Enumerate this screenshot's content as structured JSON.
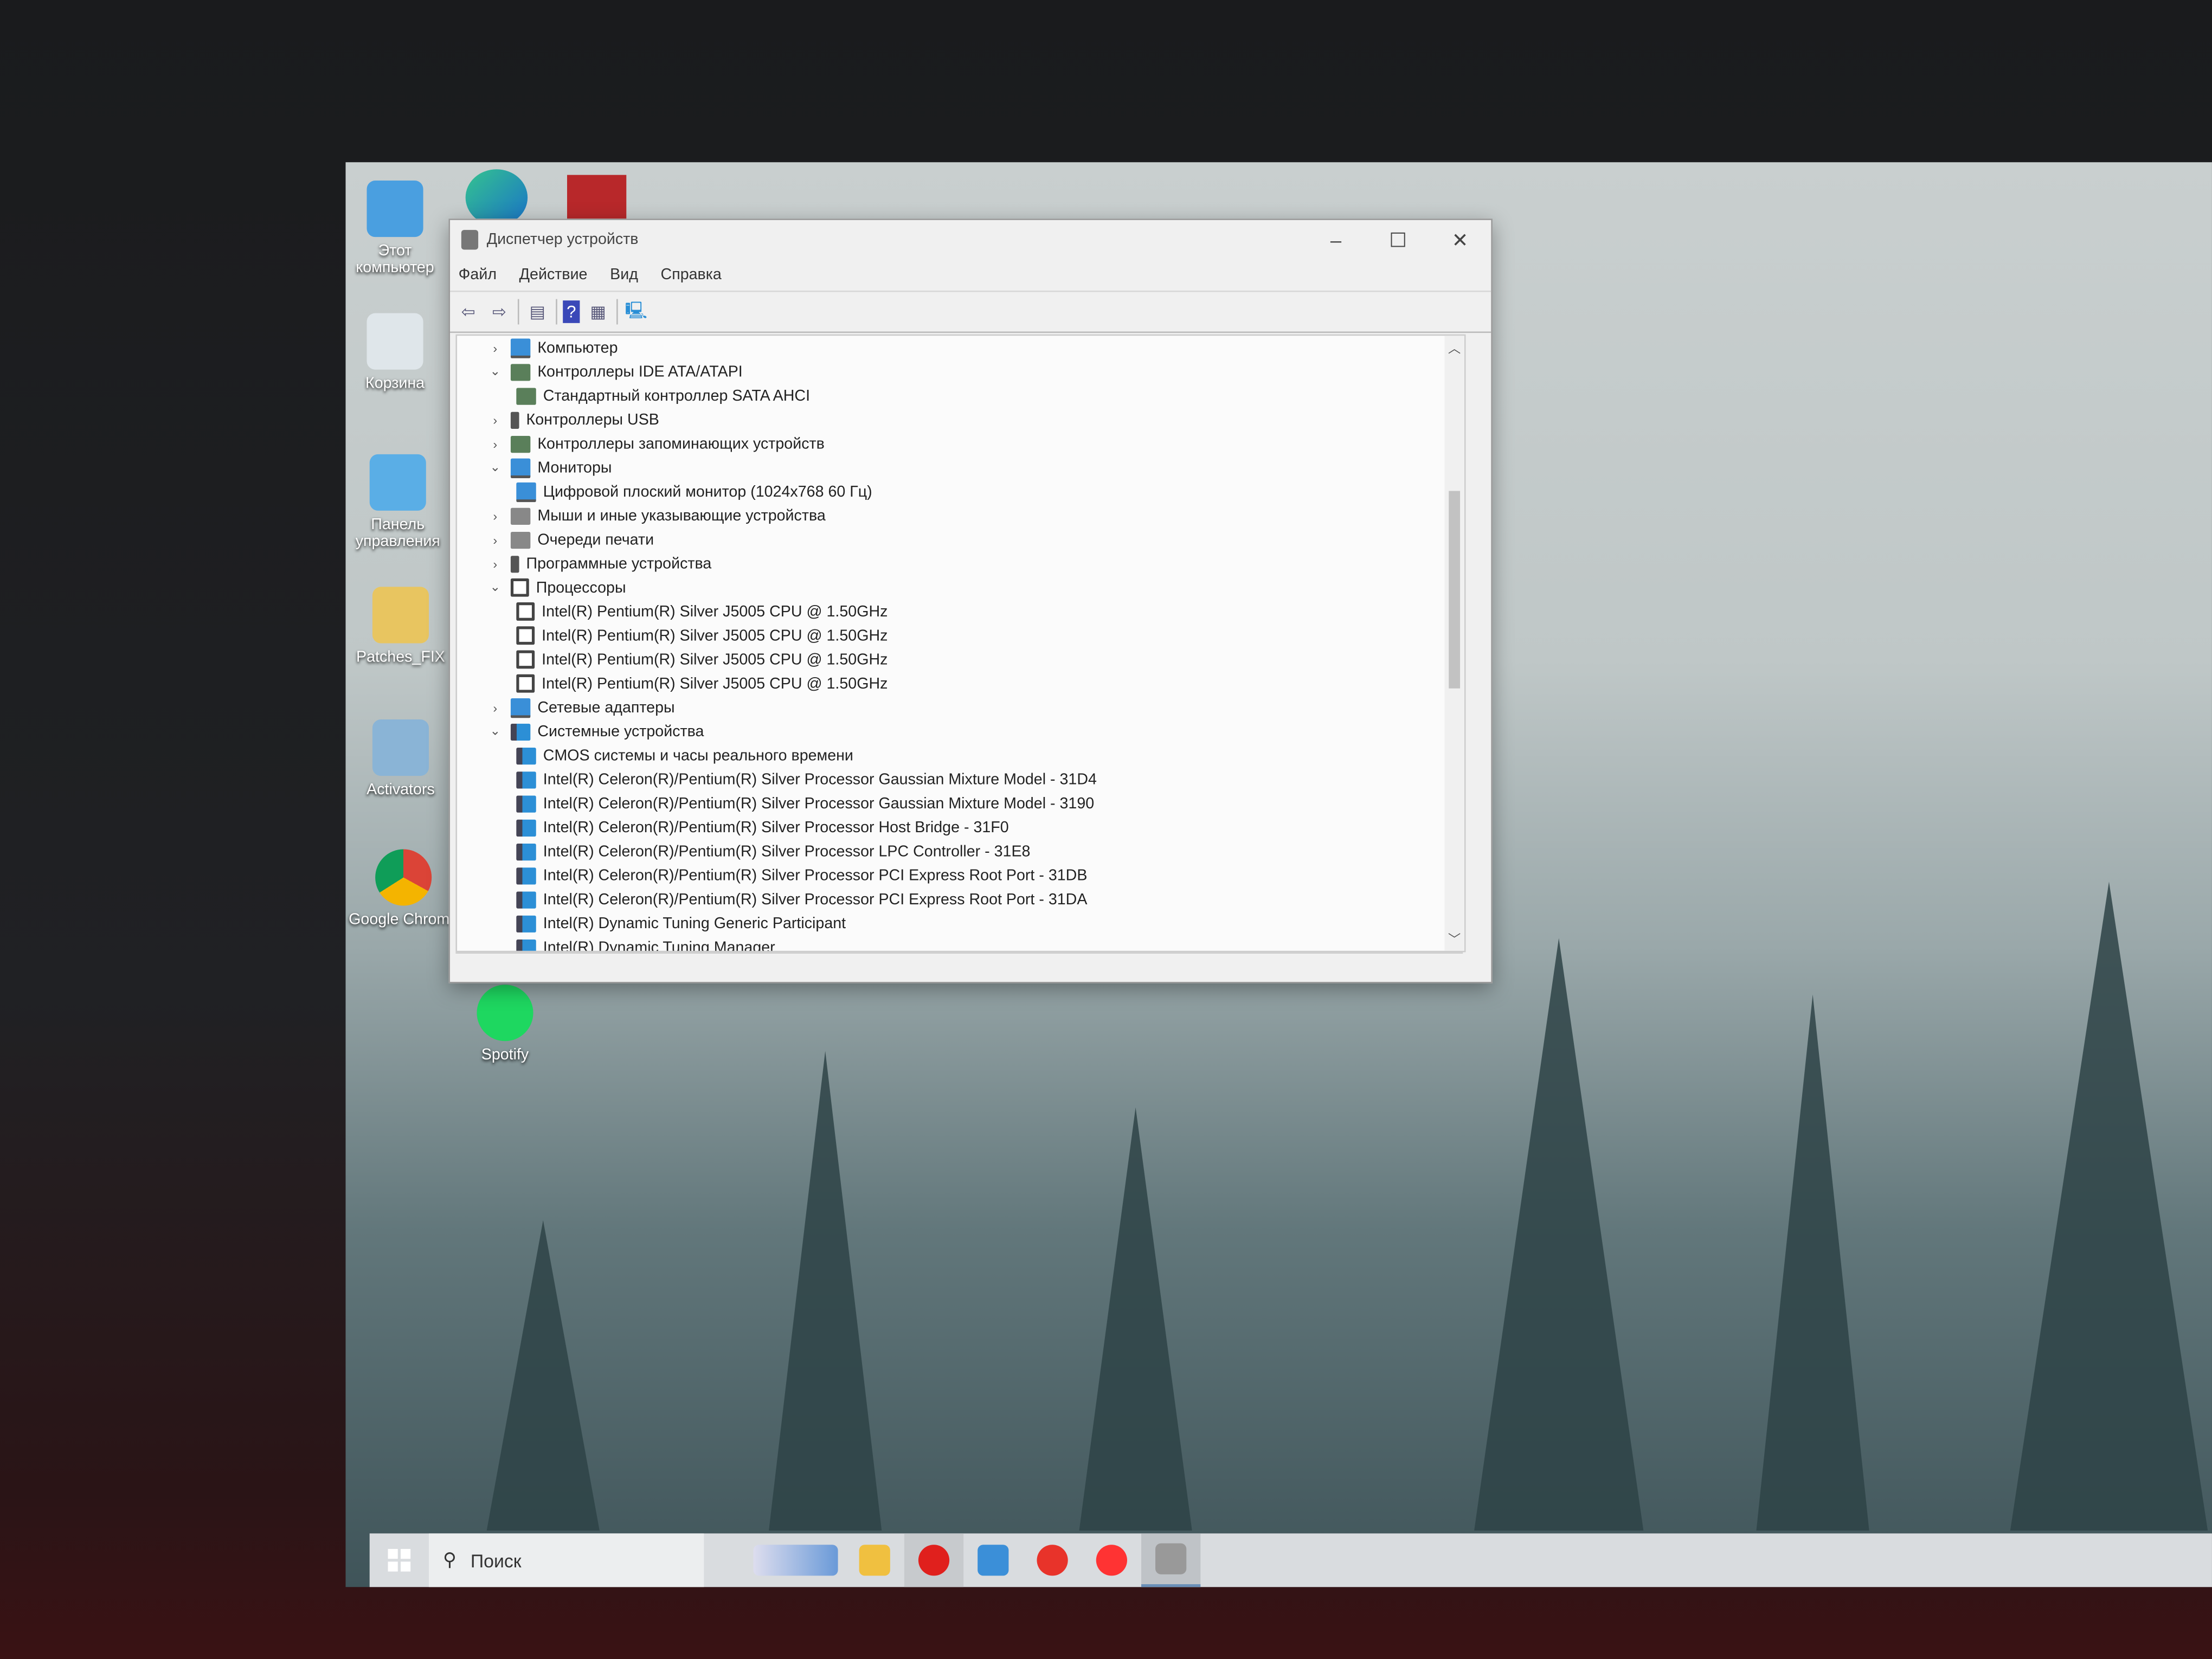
{
  "window": {
    "title": "Диспетчер устройств",
    "menu": [
      "Файл",
      "Действие",
      "Вид",
      "Справка"
    ],
    "controls": {
      "minimize": "–",
      "maximize": "☐",
      "close": "✕"
    }
  },
  "tree": [
    {
      "label": "Компьютер",
      "level": 0,
      "state": "collapsed",
      "icon": "computer-icon"
    },
    {
      "label": "Контроллеры IDE ATA/ATAPI",
      "level": 0,
      "state": "expanded",
      "icon": "controller-icon"
    },
    {
      "label": "Стандартный контроллер SATA AHCI",
      "level": 1,
      "icon": "controller-icon"
    },
    {
      "label": "Контроллеры USB",
      "level": 0,
      "state": "collapsed",
      "icon": "usb-icon"
    },
    {
      "label": "Контроллеры запоминающих устройств",
      "level": 0,
      "state": "collapsed",
      "icon": "storage-icon"
    },
    {
      "label": "Мониторы",
      "level": 0,
      "state": "expanded",
      "icon": "monitor-icon"
    },
    {
      "label": "Цифровой плоский монитор (1024x768 60 Гц)",
      "level": 1,
      "icon": "monitor-icon"
    },
    {
      "label": "Мыши и иные указывающие устройства",
      "level": 0,
      "state": "collapsed",
      "icon": "mouse-icon"
    },
    {
      "label": "Очереди печати",
      "level": 0,
      "state": "collapsed",
      "icon": "printer-icon"
    },
    {
      "label": "Программные устройства",
      "level": 0,
      "state": "collapsed",
      "icon": "software-device-icon"
    },
    {
      "label": "Процессоры",
      "level": 0,
      "state": "expanded",
      "icon": "cpu-icon"
    },
    {
      "label": "Intel(R) Pentium(R) Silver J5005 CPU @ 1.50GHz",
      "level": 1,
      "icon": "cpu-icon"
    },
    {
      "label": "Intel(R) Pentium(R) Silver J5005 CPU @ 1.50GHz",
      "level": 1,
      "icon": "cpu-icon"
    },
    {
      "label": "Intel(R) Pentium(R) Silver J5005 CPU @ 1.50GHz",
      "level": 1,
      "icon": "cpu-icon"
    },
    {
      "label": "Intel(R) Pentium(R) Silver J5005 CPU @ 1.50GHz",
      "level": 1,
      "icon": "cpu-icon"
    },
    {
      "label": "Сетевые адаптеры",
      "level": 0,
      "state": "collapsed",
      "icon": "network-icon"
    },
    {
      "label": "Системные устройства",
      "level": 0,
      "state": "expanded",
      "icon": "system-icon"
    },
    {
      "label": "CMOS системы и часы реального времени",
      "level": 1,
      "icon": "system-icon"
    },
    {
      "label": "Intel(R) Celeron(R)/Pentium(R) Silver Processor Gaussian Mixture Model - 31D4",
      "level": 1,
      "icon": "system-icon"
    },
    {
      "label": "Intel(R) Celeron(R)/Pentium(R) Silver Processor Gaussian Mixture Model - 3190",
      "level": 1,
      "icon": "system-icon"
    },
    {
      "label": "Intel(R) Celeron(R)/Pentium(R) Silver Processor Host Bridge - 31F0",
      "level": 1,
      "icon": "system-icon"
    },
    {
      "label": "Intel(R) Celeron(R)/Pentium(R) Silver Processor LPC Controller - 31E8",
      "level": 1,
      "icon": "system-icon"
    },
    {
      "label": "Intel(R) Celeron(R)/Pentium(R) Silver Processor PCI Express Root Port - 31DB",
      "level": 1,
      "icon": "system-icon"
    },
    {
      "label": "Intel(R) Celeron(R)/Pentium(R) Silver Processor PCI Express Root Port - 31DA",
      "level": 1,
      "icon": "system-icon"
    },
    {
      "label": "Intel(R) Dynamic Tuning Generic Participant",
      "level": 1,
      "icon": "system-icon"
    },
    {
      "label": "Intel(R) Dynamic Tuning Manager",
      "level": 1,
      "icon": "system-icon"
    }
  ],
  "desktop": {
    "icons": [
      "Этот компьютер",
      "Корзина",
      "Панель управления",
      "Patches_FIX",
      "Activators",
      "Google Chrome",
      "Spotify"
    ]
  },
  "taskbar": {
    "search_placeholder": "Поиск"
  }
}
